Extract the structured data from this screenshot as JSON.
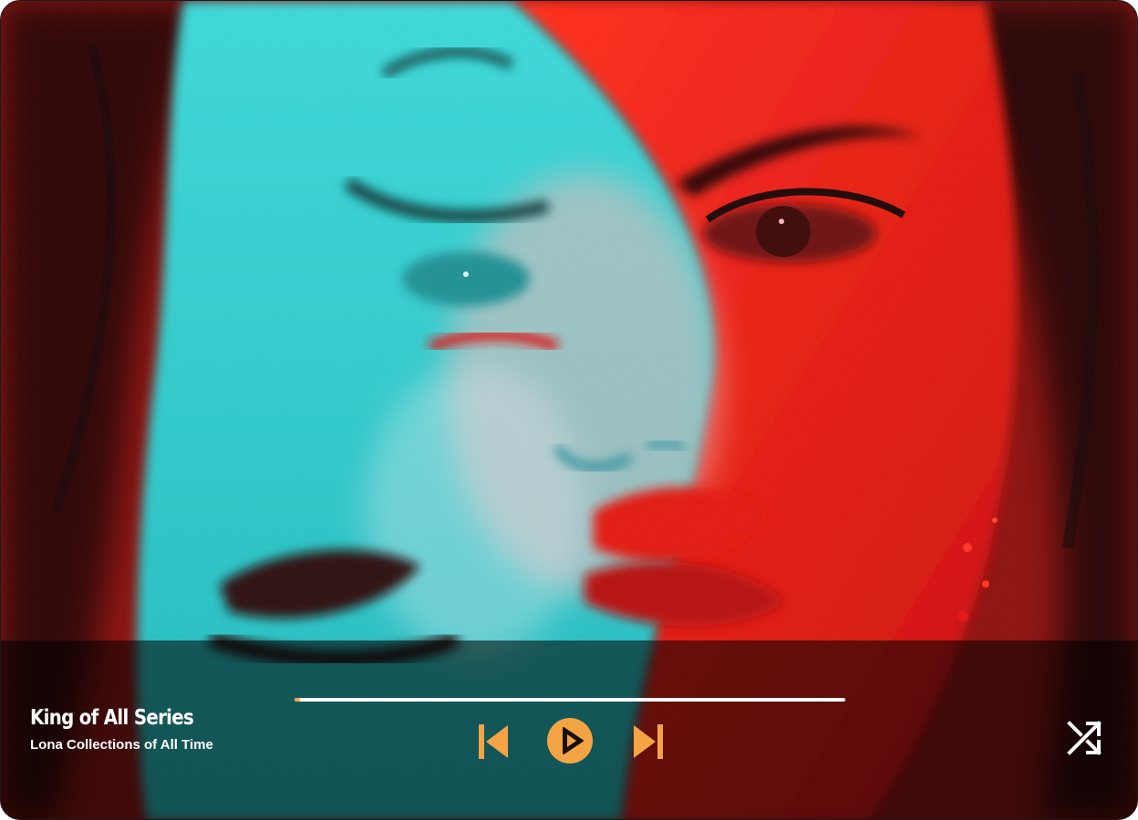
{
  "track": {
    "title": "King of All Series",
    "subtitle": "Lona Collections of All Time"
  },
  "progress": {
    "fraction": 0.01
  },
  "controls": {
    "prev_icon": "skip-previous-icon",
    "play_icon": "play-icon",
    "next_icon": "skip-next-icon",
    "shuffle_icon": "shuffle-icon"
  },
  "colors": {
    "accent": "#f5a445",
    "artwork_cyan": "#2ecfcf",
    "artwork_red": "#e8140c",
    "bar_overlay": "rgba(0,0,0,0.55)"
  }
}
